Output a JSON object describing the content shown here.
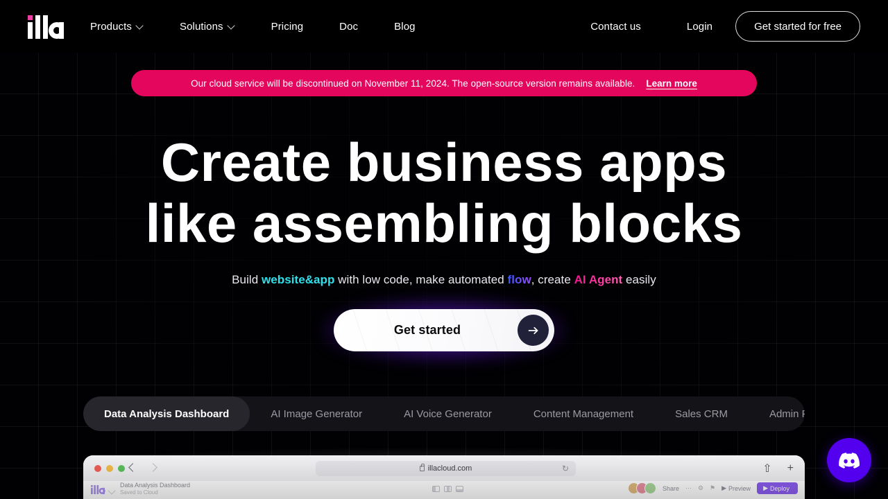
{
  "brand": {
    "name": "illa",
    "accent_pink": "#E3065C",
    "accent_purple": "#5200ee"
  },
  "header": {
    "logo_label": "illa",
    "nav": [
      {
        "label": "Products",
        "has_caret": true
      },
      {
        "label": "Solutions",
        "has_caret": true
      },
      {
        "label": "Pricing",
        "has_caret": false
      },
      {
        "label": "Doc",
        "has_caret": false
      },
      {
        "label": "Blog",
        "has_caret": false
      }
    ],
    "contact_label": "Contact us",
    "login_label": "Login",
    "cta_label": "Get started for free"
  },
  "banner": {
    "text": "Our cloud service will be discontinued on November 11, 2024. The open-source version remains available.",
    "link_label": "Learn more",
    "background": "#E3065C"
  },
  "hero": {
    "headline_line1": "Create business apps",
    "headline_line2": "like assembling blocks",
    "subtitle": {
      "part1": "Build ",
      "keyword1": "website&app",
      "part2": " with low code, make automated ",
      "keyword2": "flow",
      "part3": ", create ",
      "keyword3": "AI Agent",
      "part4": " easily"
    },
    "cta_label": "Get started",
    "cta_arrow": "arrow-right-icon"
  },
  "tabs": {
    "active_index": 0,
    "items": [
      {
        "label": "Data Analysis Dashboard"
      },
      {
        "label": "AI Image Generator"
      },
      {
        "label": "AI Voice Generator"
      },
      {
        "label": "Content Management"
      },
      {
        "label": "Sales CRM"
      },
      {
        "label": "Admin Panel"
      }
    ]
  },
  "browser_mockup": {
    "url": "illacloud.com",
    "reload_glyph": "↻",
    "share_glyph": "⇧",
    "newtab_glyph": "+",
    "app": {
      "logo_label": "illa",
      "title": "Data Analysis Dashboard",
      "subtitle": "Saved to Cloud",
      "share_label": "Share",
      "more_glyph": "⋯",
      "settings_glyph": "⚙",
      "lock_glyph": "⚑",
      "preview_label": "Preview",
      "deploy_label": "Deploy"
    }
  },
  "floating_button": {
    "name": "discord-button",
    "color": "#5200ee"
  }
}
